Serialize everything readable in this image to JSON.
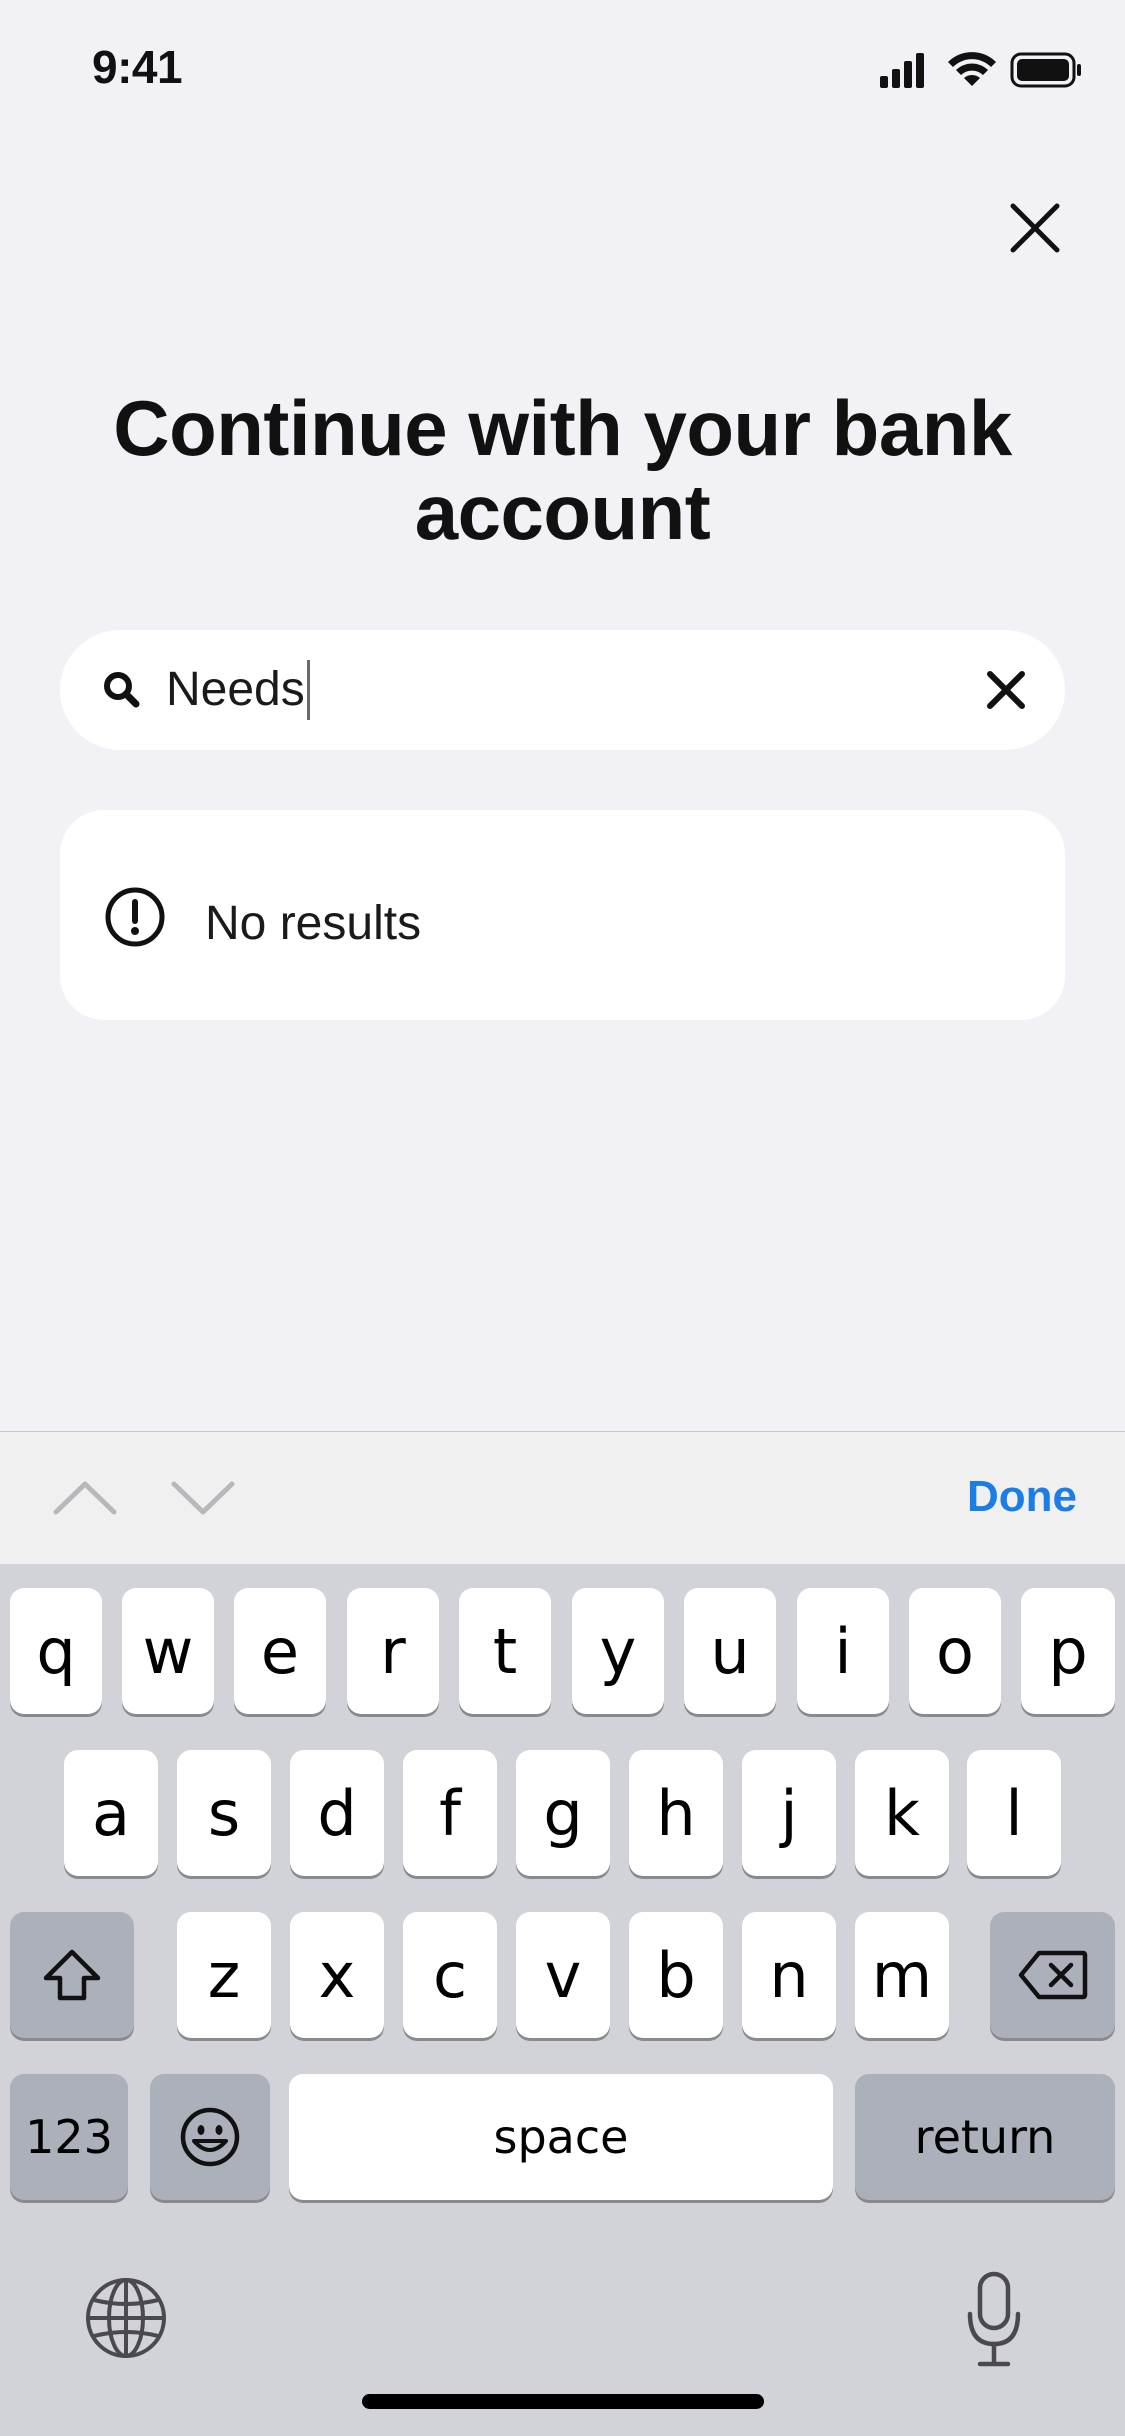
{
  "status_bar": {
    "time": "9:41",
    "icons": [
      "cellular-signal-icon",
      "wifi-icon",
      "battery-icon"
    ]
  },
  "close_icon": "close-icon",
  "title": "Continue with your bank account",
  "search": {
    "icon": "search-icon",
    "value": "Needs",
    "clear_icon": "clear-icon"
  },
  "results": {
    "icon": "alert-icon",
    "message": "No results"
  },
  "accessory_bar": {
    "prev_icon": "chevron-up-icon",
    "next_icon": "chevron-down-icon",
    "done_label": "Done"
  },
  "keyboard": {
    "row1": [
      "q",
      "w",
      "e",
      "r",
      "t",
      "y",
      "u",
      "i",
      "o",
      "p"
    ],
    "row2": [
      "a",
      "s",
      "d",
      "f",
      "g",
      "h",
      "j",
      "k",
      "l"
    ],
    "row3": [
      "z",
      "x",
      "c",
      "v",
      "b",
      "n",
      "m"
    ],
    "numbers_label": "123",
    "space_label": "space",
    "return_label": "return",
    "shift_icon": "shift-icon",
    "delete_icon": "delete-icon",
    "emoji_icon": "emoji-icon",
    "globe_icon": "globe-icon",
    "mic_icon": "microphone-icon"
  },
  "colors": {
    "background": "#f1f1f6",
    "accent": "#1a7ee6",
    "keyboard_bg": "#d1d3d9"
  }
}
